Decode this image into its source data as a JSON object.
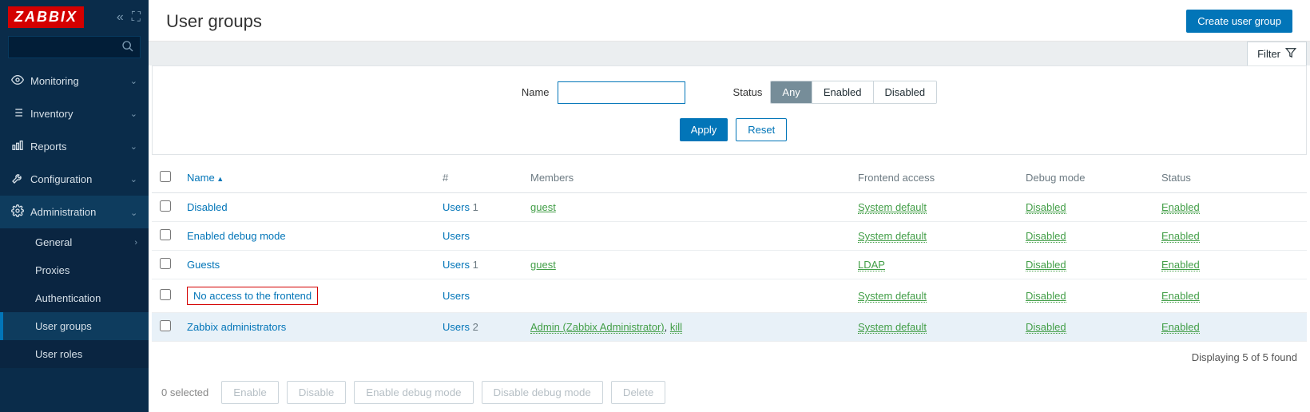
{
  "brand": "ZABBIX",
  "sidebar": {
    "search_placeholder": "",
    "items": [
      {
        "label": "Monitoring"
      },
      {
        "label": "Inventory"
      },
      {
        "label": "Reports"
      },
      {
        "label": "Configuration"
      },
      {
        "label": "Administration"
      }
    ],
    "admin_sub": [
      {
        "label": "General"
      },
      {
        "label": "Proxies"
      },
      {
        "label": "Authentication"
      },
      {
        "label": "User groups"
      },
      {
        "label": "User roles"
      }
    ]
  },
  "page": {
    "title": "User groups",
    "create_btn": "Create user group",
    "filter_tab": "Filter"
  },
  "filter": {
    "name_label": "Name",
    "name_value": "",
    "status_label": "Status",
    "status_options": {
      "any": "Any",
      "enabled": "Enabled",
      "disabled": "Disabled"
    },
    "apply": "Apply",
    "reset": "Reset"
  },
  "table": {
    "headers": {
      "name": "Name",
      "num": "#",
      "members": "Members",
      "frontend": "Frontend access",
      "debug": "Debug mode",
      "status": "Status"
    },
    "rows": [
      {
        "name": "Disabled",
        "highlight": false,
        "users_label": "Users",
        "users_count": "1",
        "members": [
          {
            "text": "guest",
            "dotted": false
          }
        ],
        "frontend": "System default",
        "debug": "Disabled",
        "status": "Enabled"
      },
      {
        "name": "Enabled debug mode",
        "highlight": false,
        "users_label": "Users",
        "users_count": "",
        "members": [],
        "frontend": "System default",
        "debug": "Disabled",
        "status": "Enabled"
      },
      {
        "name": "Guests",
        "highlight": false,
        "users_label": "Users",
        "users_count": "1",
        "members": [
          {
            "text": "guest",
            "dotted": false
          }
        ],
        "frontend": "LDAP",
        "debug": "Disabled",
        "status": "Enabled"
      },
      {
        "name": "No access to the frontend",
        "highlight": true,
        "users_label": "Users",
        "users_count": "",
        "members": [],
        "frontend": "System default",
        "debug": "Disabled",
        "status": "Enabled"
      },
      {
        "name": "Zabbix administrators",
        "highlight": false,
        "users_label": "Users",
        "users_count": "2",
        "members": [
          {
            "text": "Admin (Zabbix Administrator)",
            "dotted": true
          },
          {
            "text": "kill",
            "dotted": true
          }
        ],
        "frontend": "System default",
        "debug": "Disabled",
        "status": "Enabled"
      }
    ],
    "footer": "Displaying 5 of 5 found"
  },
  "bulk": {
    "selected": "0 selected",
    "enable": "Enable",
    "disable": "Disable",
    "enable_debug": "Enable debug mode",
    "disable_debug": "Disable debug mode",
    "delete": "Delete"
  }
}
